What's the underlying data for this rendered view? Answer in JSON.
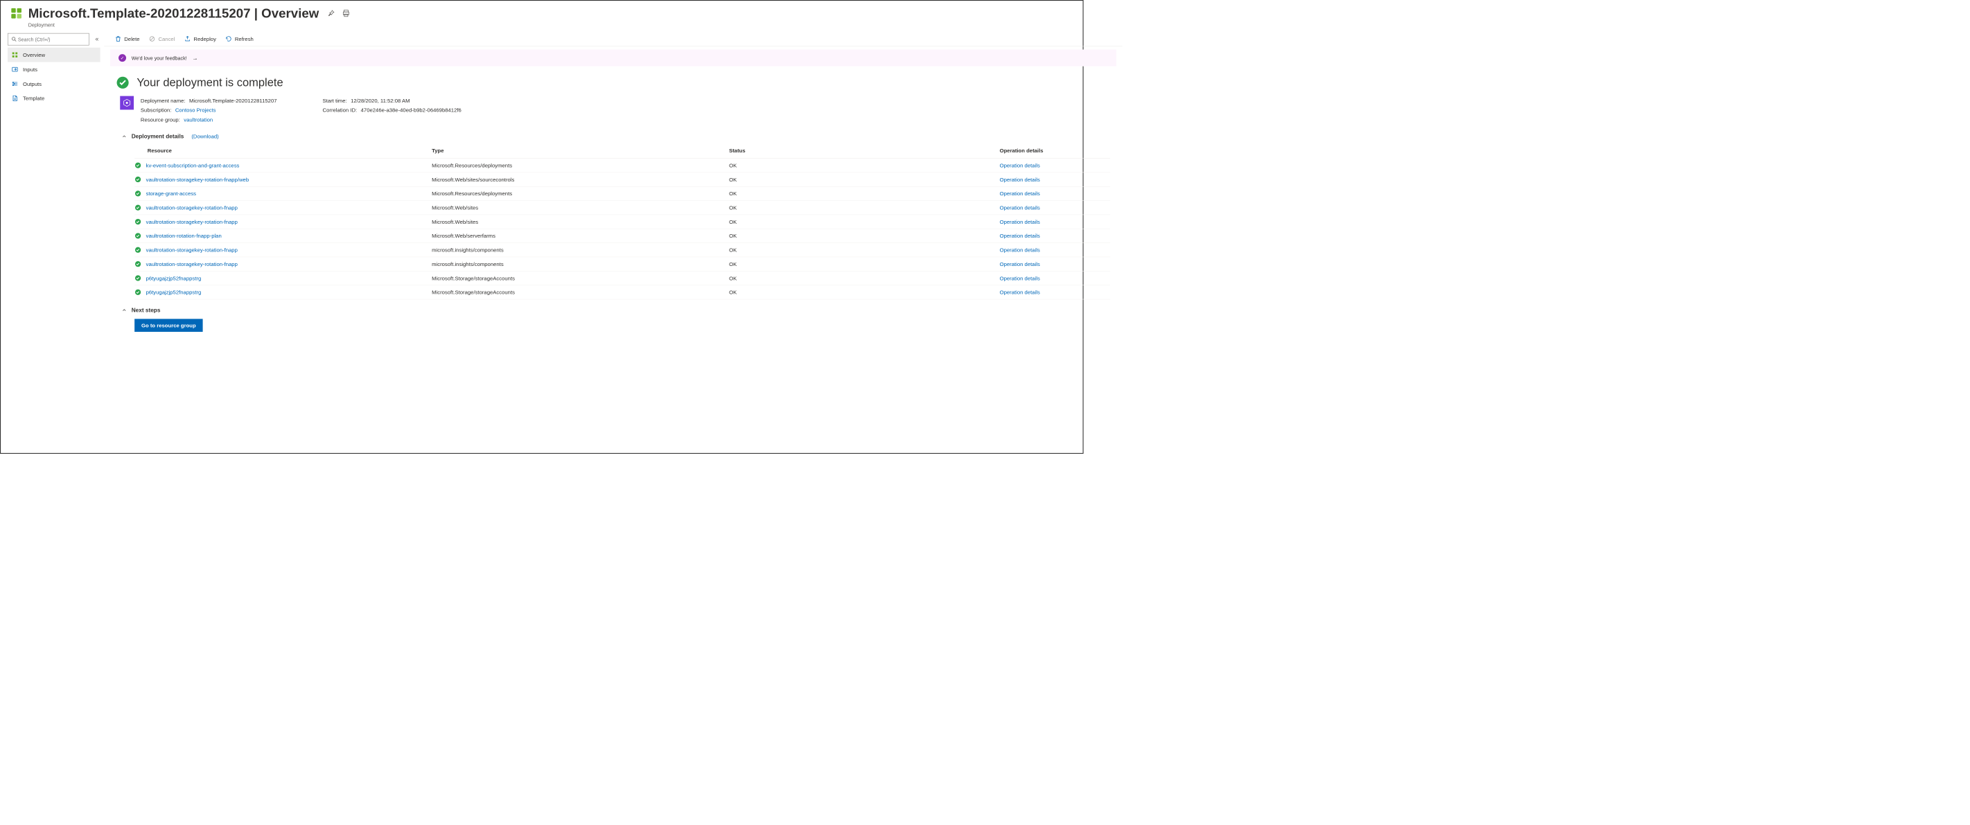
{
  "header": {
    "title": "Microsoft.Template-20201228115207 | Overview",
    "subtitle": "Deployment"
  },
  "sidebar": {
    "search_placeholder": "Search (Ctrl+/)",
    "items": [
      {
        "label": "Overview",
        "icon": "overview",
        "active": true
      },
      {
        "label": "Inputs",
        "icon": "inputs",
        "active": false
      },
      {
        "label": "Outputs",
        "icon": "outputs",
        "active": false
      },
      {
        "label": "Template",
        "icon": "template",
        "active": false
      }
    ]
  },
  "toolbar": {
    "delete": "Delete",
    "cancel": "Cancel",
    "redeploy": "Redeploy",
    "refresh": "Refresh"
  },
  "feedback": {
    "text": "We'd love your feedback!"
  },
  "status": {
    "title": "Your deployment is complete"
  },
  "info": {
    "deployment_name_label": "Deployment name:",
    "deployment_name": "Microsoft.Template-20201228115207",
    "subscription_label": "Subscription:",
    "subscription": "Contoso Projects",
    "resource_group_label": "Resource group:",
    "resource_group": "vaultrotation",
    "start_time_label": "Start time:",
    "start_time": "12/28/2020, 11:52:08 AM",
    "correlation_label": "Correlation ID:",
    "correlation": "470e246e-a38e-40ed-b9b2-06469b8412f6"
  },
  "details": {
    "header": "Deployment details",
    "download": "(Download)",
    "columns": {
      "resource": "Resource",
      "type": "Type",
      "status": "Status",
      "operation": "Operation details"
    },
    "op_link": "Operation details",
    "rows": [
      {
        "resource": "kv-event-subscription-and-grant-access",
        "type": "Microsoft.Resources/deployments",
        "status": "OK"
      },
      {
        "resource": "vaultrotation-storagekey-rotation-fnapp/web",
        "type": "Microsoft.Web/sites/sourcecontrols",
        "status": "OK"
      },
      {
        "resource": "storage-grant-access",
        "type": "Microsoft.Resources/deployments",
        "status": "OK"
      },
      {
        "resource": "vaultrotation-storagekey-rotation-fnapp",
        "type": "Microsoft.Web/sites",
        "status": "OK"
      },
      {
        "resource": "vaultrotation-storagekey-rotation-fnapp",
        "type": "Microsoft.Web/sites",
        "status": "OK"
      },
      {
        "resource": "vaultrotation-rotation-fnapp-plan",
        "type": "Microsoft.Web/serverfarms",
        "status": "OK"
      },
      {
        "resource": "vaultrotation-storagekey-rotation-fnapp",
        "type": "microsoft.insights/components",
        "status": "OK"
      },
      {
        "resource": "vaultrotation-storagekey-rotation-fnapp",
        "type": "microsoft.insights/components",
        "status": "OK"
      },
      {
        "resource": "p6tyugajzjp52fnappstrg",
        "type": "Microsoft.Storage/storageAccounts",
        "status": "OK"
      },
      {
        "resource": "p6tyugajzjp52fnappstrg",
        "type": "Microsoft.Storage/storageAccounts",
        "status": "OK"
      }
    ]
  },
  "next_steps": {
    "header": "Next steps",
    "button": "Go to resource group"
  }
}
